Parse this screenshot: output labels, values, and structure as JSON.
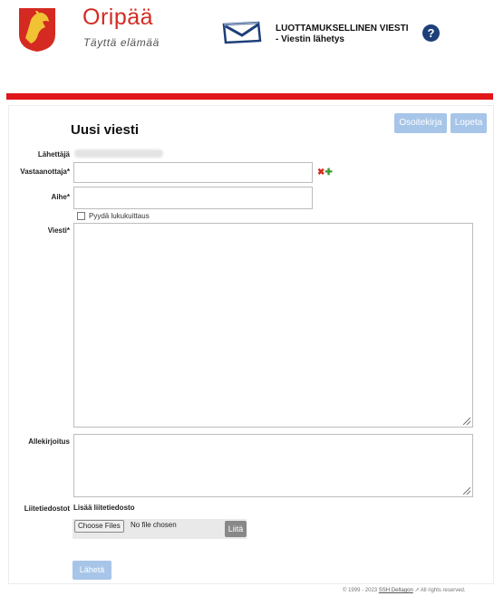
{
  "header": {
    "municipality_name": "Oripää",
    "slogan": "Täyttä elämää",
    "secure_title": "LUOTTAMUKSELLINEN VIESTI",
    "secure_subtitle": "- Viestin lähetys",
    "help_label": "?"
  },
  "toolbar": {
    "address_book_label": "Osoitekirja",
    "quit_label": "Lopeta"
  },
  "form": {
    "title": "Uusi viesti",
    "sender_label": "Lähettäjä",
    "recipient_label": "Vastaanottaja*",
    "recipient_value": "",
    "subject_label": "Aihe*",
    "subject_value": "",
    "read_receipt_label": "Pyydä lukukuittaus",
    "read_receipt_checked": false,
    "message_label": "Viesti*",
    "message_value": "",
    "signature_label": "Allekirjoitus",
    "signature_value": "",
    "attachments_label": "Liitetiedostot",
    "add_attachment_label": "Lisää liitetiedosto",
    "choose_files_label": "Choose Files",
    "no_file_label": "No file chosen",
    "attach_label": "Liitä",
    "send_label": "Lähetä"
  },
  "footer": {
    "copyright_prefix": "© 1999 - 2023",
    "vendor_link": "SSH Deltagon",
    "rights": "All rights reserved."
  },
  "colors": {
    "brand_red": "#e0161a",
    "button_blue": "#a7c5e8",
    "help_navy": "#1d3f7a"
  }
}
